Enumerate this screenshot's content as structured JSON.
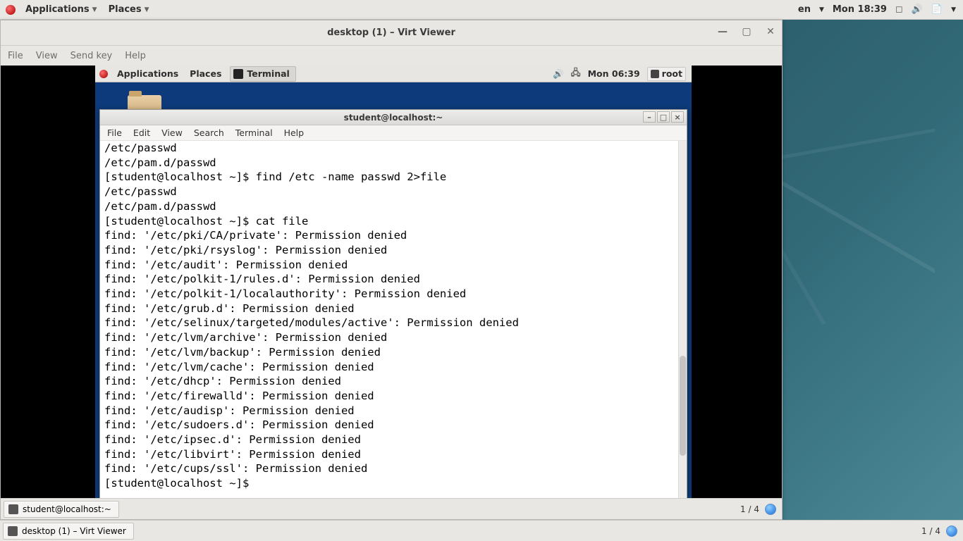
{
  "host": {
    "topbar": {
      "applications": "Applications",
      "places": "Places",
      "lang": "en",
      "clock": "Mon 18:39"
    },
    "bottombar": {
      "task_label": "desktop (1) – Virt Viewer",
      "workspace": "1 / 4"
    }
  },
  "virtviewer": {
    "title": "desktop (1) – Virt Viewer",
    "menu": {
      "file": "File",
      "view": "View",
      "sendkey": "Send key",
      "help": "Help"
    },
    "bottom": {
      "task_label": "student@localhost:~",
      "workspace": "1 / 4"
    }
  },
  "guest": {
    "topbar": {
      "applications": "Applications",
      "places": "Places",
      "terminal_task": "Terminal",
      "clock": "Mon 06:39",
      "user": "root"
    }
  },
  "terminal": {
    "title": "student@localhost:~",
    "menu": {
      "file": "File",
      "edit": "Edit",
      "view": "View",
      "search": "Search",
      "terminal": "Terminal",
      "help": "Help"
    },
    "lines": [
      "/etc/passwd",
      "/etc/pam.d/passwd",
      "[student@localhost ~]$ find /etc -name passwd 2>file",
      "/etc/passwd",
      "/etc/pam.d/passwd",
      "[student@localhost ~]$ cat file",
      "find: '/etc/pki/CA/private': Permission denied",
      "find: '/etc/pki/rsyslog': Permission denied",
      "find: '/etc/audit': Permission denied",
      "find: '/etc/polkit-1/rules.d': Permission denied",
      "find: '/etc/polkit-1/localauthority': Permission denied",
      "find: '/etc/grub.d': Permission denied",
      "find: '/etc/selinux/targeted/modules/active': Permission denied",
      "find: '/etc/lvm/archive': Permission denied",
      "find: '/etc/lvm/backup': Permission denied",
      "find: '/etc/lvm/cache': Permission denied",
      "find: '/etc/dhcp': Permission denied",
      "find: '/etc/firewalld': Permission denied",
      "find: '/etc/audisp': Permission denied",
      "find: '/etc/sudoers.d': Permission denied",
      "find: '/etc/ipsec.d': Permission denied",
      "find: '/etc/libvirt': Permission denied",
      "find: '/etc/cups/ssl': Permission denied",
      "[student@localhost ~]$ "
    ]
  }
}
